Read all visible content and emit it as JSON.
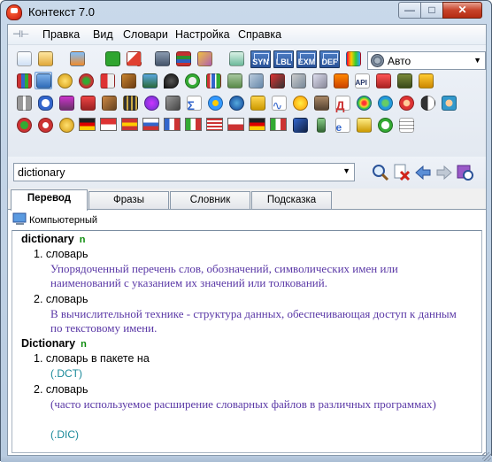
{
  "window": {
    "title": "Контекст 7.0",
    "min_label": "—",
    "max_label": "□",
    "close_label": "✕"
  },
  "menu": {
    "items": [
      "Правка",
      "Вид",
      "Словари",
      "Настройка",
      "Справка"
    ]
  },
  "toolbar": {
    "tag_buttons": [
      "SYN",
      "LBL",
      "EXM",
      "DEF"
    ],
    "mode": "Авто"
  },
  "search": {
    "value": "dictionary"
  },
  "tabs": [
    "Перевод",
    "Фразы",
    "Словник",
    "Подсказка"
  ],
  "dictionary": {
    "name": "Компьютерный"
  },
  "article": {
    "entries": [
      {
        "headword": "dictionary",
        "pos": "n",
        "senses": [
          {
            "num": "1.",
            "term": "словарь",
            "definition": "Упорядоченный перечень слов, обозначений, символических имен или наименований с указанием их значений или толкований."
          },
          {
            "num": "2.",
            "term": "словарь",
            "definition": "В вычислительной технике - структура данных, обеспечивающая доступ к данным по текстовому имени."
          }
        ]
      },
      {
        "headword": "Dictionary",
        "pos": "n",
        "senses": [
          {
            "num": "1.",
            "term": "словарь в пакете на",
            "link": "(.DCT)"
          },
          {
            "num": "2.",
            "term": "словарь",
            "definition": "(часто используемое расширение словарных файлов в различных программах)",
            "link": "(.DIC)"
          }
        ]
      }
    ]
  },
  "colors": {
    "accent": "#2a5298",
    "definition": "#5a38a6",
    "link": "#1a8a9a",
    "pos": "#0a8a0a"
  }
}
